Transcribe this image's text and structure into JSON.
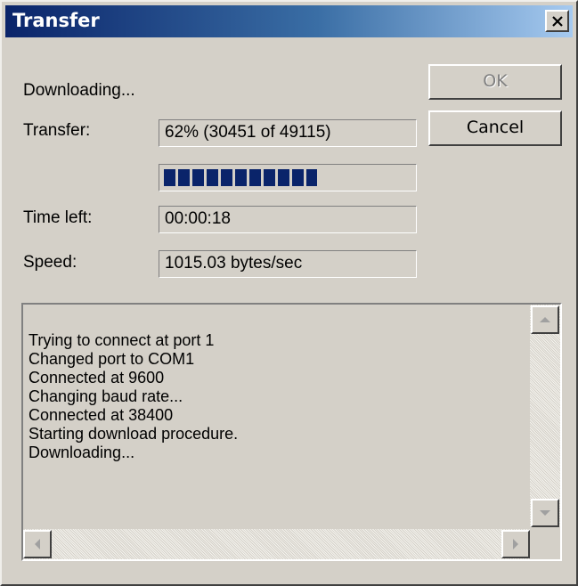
{
  "window": {
    "title": "Transfer",
    "close_symbol": "✕"
  },
  "status": {
    "heading": "Downloading..."
  },
  "fields": {
    "transfer_label": "Transfer:",
    "transfer_value": "62% (30451 of 49115)",
    "time_left_label": "Time left:",
    "time_left_value": "00:00:18",
    "speed_label": "Speed:",
    "speed_value": "1015.03 bytes/sec"
  },
  "progress": {
    "fraction": 0.62
  },
  "buttons": {
    "ok_label": "OK",
    "cancel_label": "Cancel"
  },
  "log": {
    "lines": [
      "Trying to connect at port 1",
      "Changed port to COM1",
      "Connected at 9600",
      "Changing baud rate...",
      "Connected at 38400",
      "Starting download procedure.",
      "Downloading..."
    ]
  },
  "colors": {
    "progress_fill": "#0a246a",
    "title_gradient_start": "#0a246a",
    "dialog_background": "#d4d0c8"
  },
  "icons": {
    "close": "close-icon",
    "scroll_up": "arrow-up-icon",
    "scroll_down": "arrow-down-icon",
    "scroll_left": "arrow-left-icon",
    "scroll_right": "arrow-right-icon"
  }
}
